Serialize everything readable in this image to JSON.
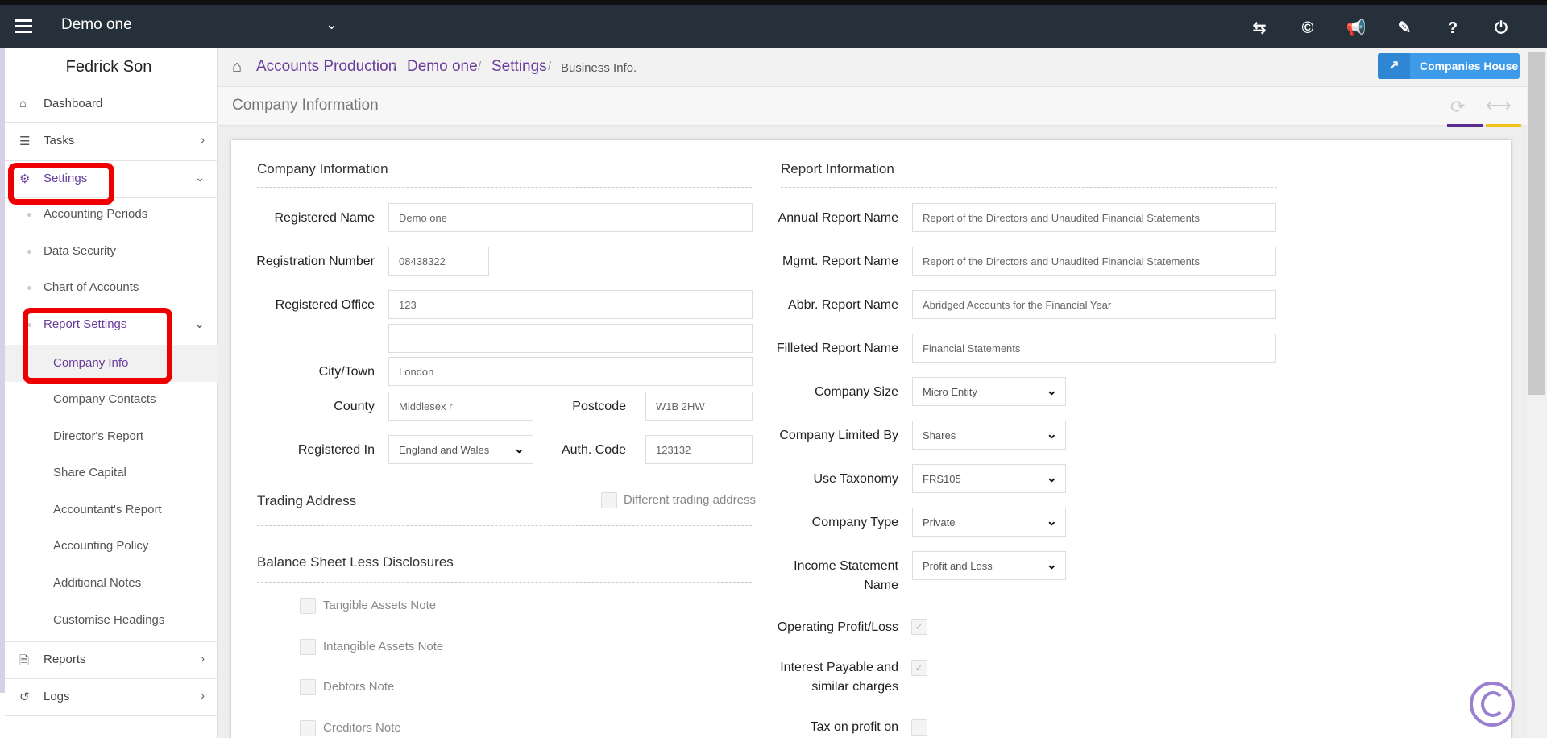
{
  "topbar": {
    "company": "Demo one"
  },
  "sidebar": {
    "user": "Fedrick Son",
    "items": [
      {
        "label": "Dashboard"
      },
      {
        "label": "Tasks"
      },
      {
        "label": "Settings"
      },
      {
        "label": "Accounting Periods"
      },
      {
        "label": "Data Security"
      },
      {
        "label": "Chart of Accounts"
      },
      {
        "label": "Report Settings"
      },
      {
        "label": "Company Info"
      },
      {
        "label": "Company Contacts"
      },
      {
        "label": "Director's Report"
      },
      {
        "label": "Share Capital"
      },
      {
        "label": "Accountant's Report"
      },
      {
        "label": "Accounting Policy"
      },
      {
        "label": "Additional Notes"
      },
      {
        "label": "Customise Headings"
      },
      {
        "label": "Reports"
      },
      {
        "label": "Logs"
      }
    ]
  },
  "breadcrumb": {
    "items": [
      "Accounts Production",
      "Demo one",
      "Settings"
    ],
    "current": "Business Info."
  },
  "companies_house_label": "Companies House",
  "panel_title": "Company Information",
  "company_info": {
    "heading": "Company Information",
    "registered_name": {
      "label": "Registered Name",
      "value": "Demo one"
    },
    "registration_number": {
      "label": "Registration Number",
      "value": "08438322"
    },
    "registered_office": {
      "label": "Registered Office",
      "value": "123",
      "value2": ""
    },
    "city": {
      "label": "City/Town",
      "value": "London"
    },
    "county": {
      "label": "County",
      "value": "Middlesex r"
    },
    "postcode": {
      "label": "Postcode",
      "value": "W1B 2HW"
    },
    "registered_in": {
      "label": "Registered In",
      "value": "England and Wales"
    },
    "auth_code": {
      "label": "Auth. Code",
      "value": "123132"
    }
  },
  "trading": {
    "heading": "Trading Address",
    "checkbox_label": "Different trading address"
  },
  "balance_sheet": {
    "heading": "Balance Sheet Less Disclosures",
    "notes": [
      "Tangible Assets Note",
      "Intangible Assets Note",
      "Debtors Note",
      "Creditors Note"
    ]
  },
  "report_info": {
    "heading": "Report Information",
    "annual": {
      "label": "Annual Report Name",
      "value": "Report of the Directors and Unaudited Financial Statements"
    },
    "mgmt": {
      "label": "Mgmt. Report Name",
      "value": "Report of the Directors and Unaudited Financial Statements"
    },
    "abbr": {
      "label": "Abbr. Report Name",
      "value": "Abridged Accounts for the Financial Year"
    },
    "filleted": {
      "label": "Filleted Report Name",
      "value": "Financial Statements"
    },
    "size": {
      "label": "Company Size",
      "value": "Micro Entity"
    },
    "limited": {
      "label": "Company Limited By",
      "value": "Shares"
    },
    "taxonomy": {
      "label": "Use Taxonomy",
      "value": "FRS105"
    },
    "type": {
      "label": "Company Type",
      "value": "Private"
    },
    "income": {
      "label1": "Income Statement",
      "label2": "Name",
      "value": "Profit and Loss"
    },
    "operating": {
      "label": "Operating Profit/Loss"
    },
    "interest": {
      "label1": "Interest Payable and",
      "label2": "similar charges"
    },
    "tax": {
      "label": "Tax on profit on"
    }
  },
  "colors": {
    "accent": "#6a3d9a",
    "topbar": "#25303a",
    "button": "#3d9be9",
    "highlight": "#ee0000"
  }
}
